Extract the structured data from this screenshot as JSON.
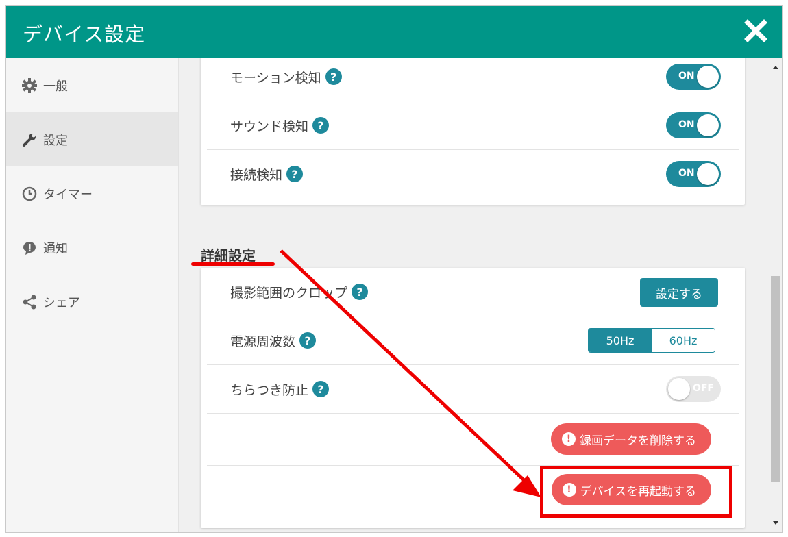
{
  "window": {
    "title": "デバイス設定"
  },
  "sidebar": {
    "items": [
      {
        "label": "一般",
        "icon": "gear-icon"
      },
      {
        "label": "設定",
        "icon": "wrench-icon"
      },
      {
        "label": "タイマー",
        "icon": "clock-icon"
      },
      {
        "label": "通知",
        "icon": "notification-icon"
      },
      {
        "label": "シェア",
        "icon": "share-icon"
      }
    ],
    "active_index": 1
  },
  "detection": {
    "rows": [
      {
        "label": "モーション検知",
        "toggle": "ON"
      },
      {
        "label": "サウンド検知",
        "toggle": "ON"
      },
      {
        "label": "接続検知",
        "toggle": "ON"
      }
    ]
  },
  "advanced": {
    "title": "詳細設定",
    "crop_label": "撮影範囲のクロップ",
    "crop_button": "設定する",
    "freq_label": "電源周波数",
    "freq_options": [
      "50Hz",
      "60Hz"
    ],
    "freq_selected": "50Hz",
    "flicker_label": "ちらつき防止",
    "flicker_toggle": "OFF",
    "delete_button": "録画データを削除する",
    "restart_button": "デバイスを再起動する"
  },
  "help_glyph": "?",
  "alert_glyph": "!",
  "colors": {
    "header": "#009688",
    "accent": "#1e8a9c",
    "danger": "#ee5a5a",
    "annotation": "#e00000"
  }
}
